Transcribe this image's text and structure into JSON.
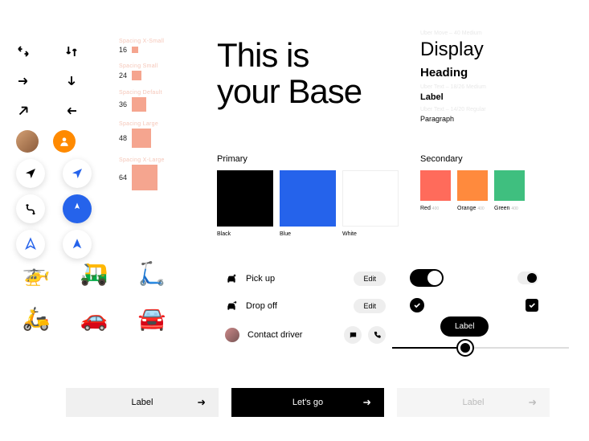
{
  "hero": {
    "line1": "This is",
    "line2": "your Base"
  },
  "spacing": [
    {
      "label": "Spacing X-Small",
      "num": "16",
      "size": 8
    },
    {
      "label": "Spacing Small",
      "num": "24",
      "size": 12
    },
    {
      "label": "Spacing Default",
      "num": "36",
      "size": 18
    },
    {
      "label": "Spacing Large",
      "num": "48",
      "size": 24
    },
    {
      "label": "Spacing X-Large",
      "num": "64",
      "size": 32
    }
  ],
  "typography": {
    "hint1": "Uber Move – 40 Medium",
    "display": "Display",
    "heading": "Heading",
    "hint2": "Uber Text – 18/26 Medium",
    "label": "Label",
    "hint3": "Uber Text – 14/20 Regular",
    "paragraph": "Paragraph"
  },
  "primary": {
    "title": "Primary",
    "swatches": [
      {
        "name": "Black",
        "hex": "#000000"
      },
      {
        "name": "Blue",
        "hex": "#2563eb"
      },
      {
        "name": "White",
        "hex": "#ffffff"
      }
    ]
  },
  "secondary": {
    "title": "Secondary",
    "swatches": [
      {
        "name": "Red",
        "sub": "400",
        "hex": "#ff6b5b"
      },
      {
        "name": "Orange",
        "sub": "400",
        "hex": "#ff8a3d"
      },
      {
        "name": "Green",
        "sub": "400",
        "hex": "#3fbf7f"
      }
    ]
  },
  "list": {
    "pickup": {
      "label": "Pick up",
      "action": "Edit"
    },
    "dropoff": {
      "label": "Drop off",
      "action": "Edit"
    },
    "contact": {
      "label": "Contact driver"
    }
  },
  "tooltip": "Label",
  "buttons": {
    "light": "Label",
    "dark": "Let's go",
    "faint": "Label"
  }
}
